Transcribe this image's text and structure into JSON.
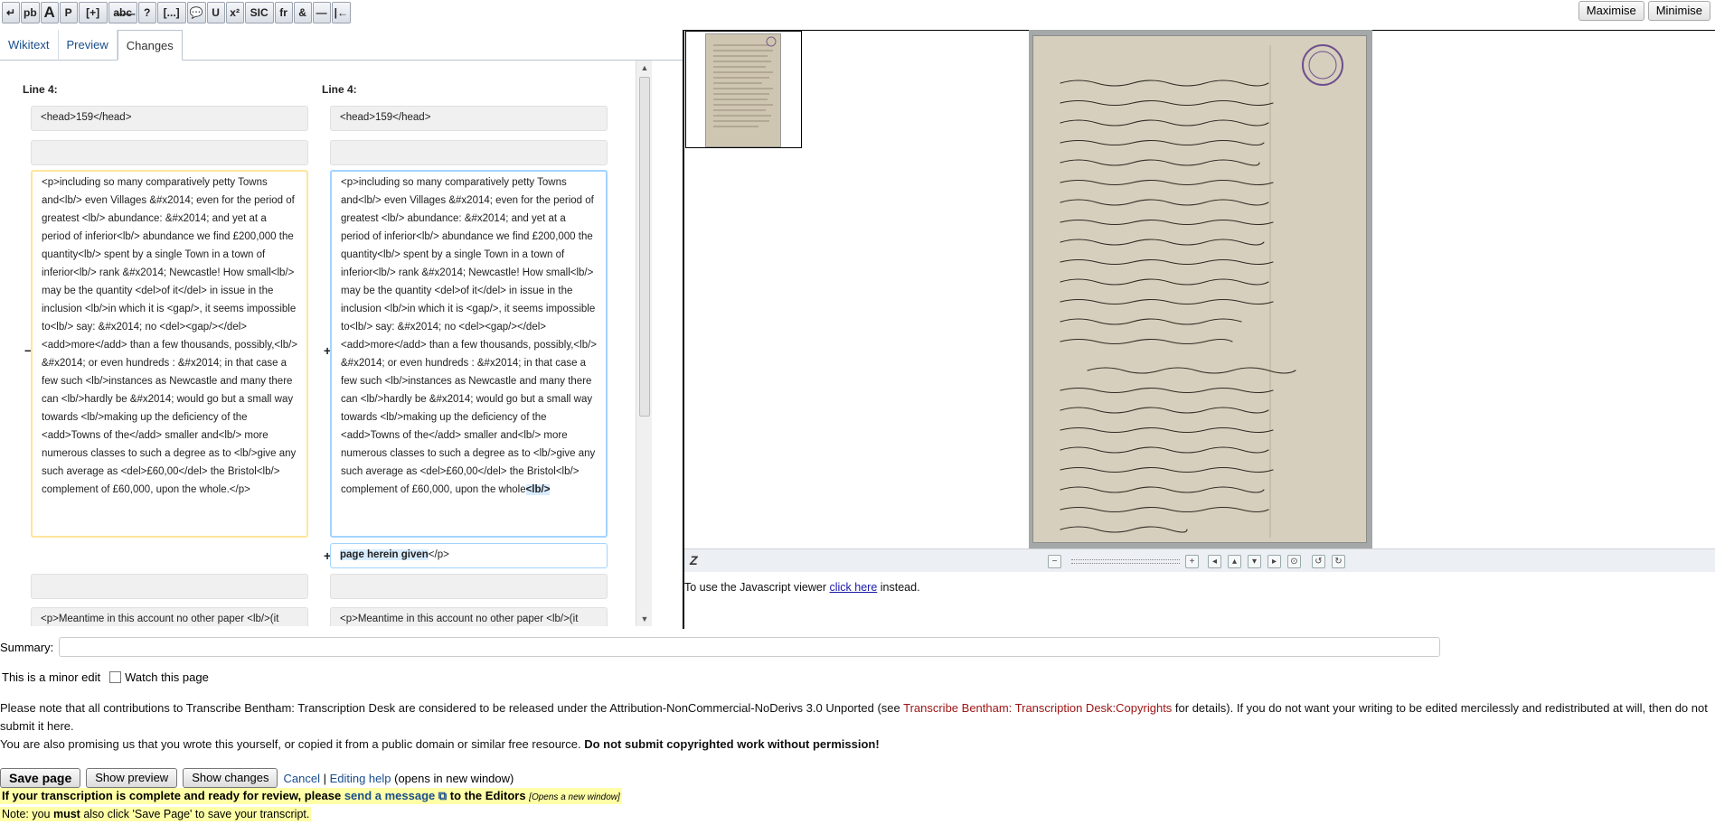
{
  "toolbar": {
    "buttons": [
      {
        "label": "↵",
        "icon": "line-break-icon"
      },
      {
        "label": "pb",
        "icon": "page-break-icon"
      },
      {
        "label": "A",
        "icon": "heading-icon"
      },
      {
        "label": "P",
        "icon": "paragraph-icon"
      },
      {
        "label": "[+]",
        "icon": "addition-icon"
      },
      {
        "label": "a̶b̶c̶",
        "icon": "deletion-icon"
      },
      {
        "label": "?",
        "icon": "questionable-icon"
      },
      {
        "label": "[...]",
        "icon": "illegible-icon"
      },
      {
        "label": "💬",
        "icon": "note-icon"
      },
      {
        "label": "U",
        "icon": "underline-icon"
      },
      {
        "label": "x²",
        "icon": "superscript-icon"
      },
      {
        "label": "SIC",
        "icon": "sic-icon"
      },
      {
        "label": "fr",
        "icon": "foreign-icon"
      },
      {
        "label": "&",
        "icon": "ampersand-icon"
      },
      {
        "label": "—",
        "icon": "dash-icon"
      },
      {
        "label": "|←",
        "icon": "margin-icon"
      }
    ],
    "maximise": "Maximise",
    "minimise": "Minimise"
  },
  "tabs": [
    {
      "label": "Wikitext"
    },
    {
      "label": "Preview"
    },
    {
      "label": "Changes"
    }
  ],
  "diff": {
    "left_header": "Line 4:",
    "right_header": "Line 4:",
    "head_text": "<head>159</head>",
    "left_para_before": "<p>including so many comparatively petty Towns and<lb/> even Villages &#x2014; even for the period of greatest <lb/> abundance: &#x2014; and yet at a period of inferior<lb/> abundance we find £200,000 the quantity<lb/> spent by a single Town in a town of inferior<lb/> rank &#x2014; Newcastle! How small<lb/> may be the quantity <del>of it</del> in issue in the inclusion <lb/>in which it is <gap/>, it seems impossible to<lb/> say: &#x2014; no <del><gap/></del> <add>more</add> than a few thousands, possibly,<lb/> &#x2014; or even hundreds : &#x2014; in that case a few such <lb/>instances as Newcastle and many there can <lb/>hardly be &#x2014; would go but a small way towards <lb/>making up the deficiency of the <add>Towns of the</add> smaller and<lb/> more numerous classes to such a degree as to <lb/>give any such average as <del>£60,00</del> the Bristol<lb/> complement of £60,000, upon the whole",
    "left_para_after": ".</p>",
    "right_para_before": "<p>including so many comparatively petty Towns and<lb/> even Villages &#x2014; even for the period of greatest <lb/> abundance: &#x2014; and yet at a period of inferior<lb/> abundance we find £200,000 the quantity<lb/> spent by a single Town in a town of inferior<lb/> rank &#x2014; Newcastle! How small<lb/> may be the quantity <del>of it</del> in issue in the inclusion <lb/>in which it is <gap/>, it seems impossible to<lb/> say: &#x2014; no <del><gap/></del> <add>more</add> than a few thousands, possibly,<lb/> &#x2014; or even hundreds : &#x2014; in that case a few such <lb/>instances as Newcastle and many there can <lb/>hardly be &#x2014; would go but a small way towards <lb/>making up the deficiency of the <add>Towns of the</add> smaller and<lb/> more numerous classes to such a degree as to <lb/>give any such average as <del>£60,00</del> the Bristol<lb/> complement of £60,000, upon the whole",
    "right_para_added": "<lb/>",
    "added_line_hl": "page herein given",
    "added_line_rest": "</p>",
    "next_para": "<p>Meantime in this account no other paper <lb/>(it",
    "minus_marker": "−",
    "plus_marker": "+"
  },
  "viewer": {
    "zoom_logo": "Z",
    "note_before": "To use the Javascript viewer ",
    "note_link": "click here",
    "note_after": " instead."
  },
  "form": {
    "summary_label": "Summary:",
    "minor_edit": "This is a minor edit",
    "watch_page": "Watch this page",
    "notice_1": "Please note that all contributions to Transcribe Bentham: Transcription Desk are considered to be released under the Attribution-NonCommercial-NoDerivs 3.0 Unported (see ",
    "notice_link": "Transcribe Bentham: Transcription Desk:Copyrights",
    "notice_2": " for details). If you do not want your writing to be edited mercilessly and redistributed at will, then do not submit it here.",
    "notice_3": "You are also promising us that you wrote this yourself, or copied it from a public domain or similar free resource. ",
    "notice_bold": "Do not submit copyrighted work without permission!",
    "save": "Save page",
    "preview": "Show preview",
    "changes": "Show changes",
    "cancel": "Cancel",
    "sep": " | ",
    "help": "Editing help",
    "help_note": " (opens in new window)",
    "review_1": "If your transcription is complete and ready for review, please ",
    "review_link": "send a message",
    "review_2": " to the Editors ",
    "review_opens": "[Opens a new window]",
    "note_1": "Note: you ",
    "note_must": "must",
    "note_2": " also click 'Save Page' to save your transcript."
  }
}
